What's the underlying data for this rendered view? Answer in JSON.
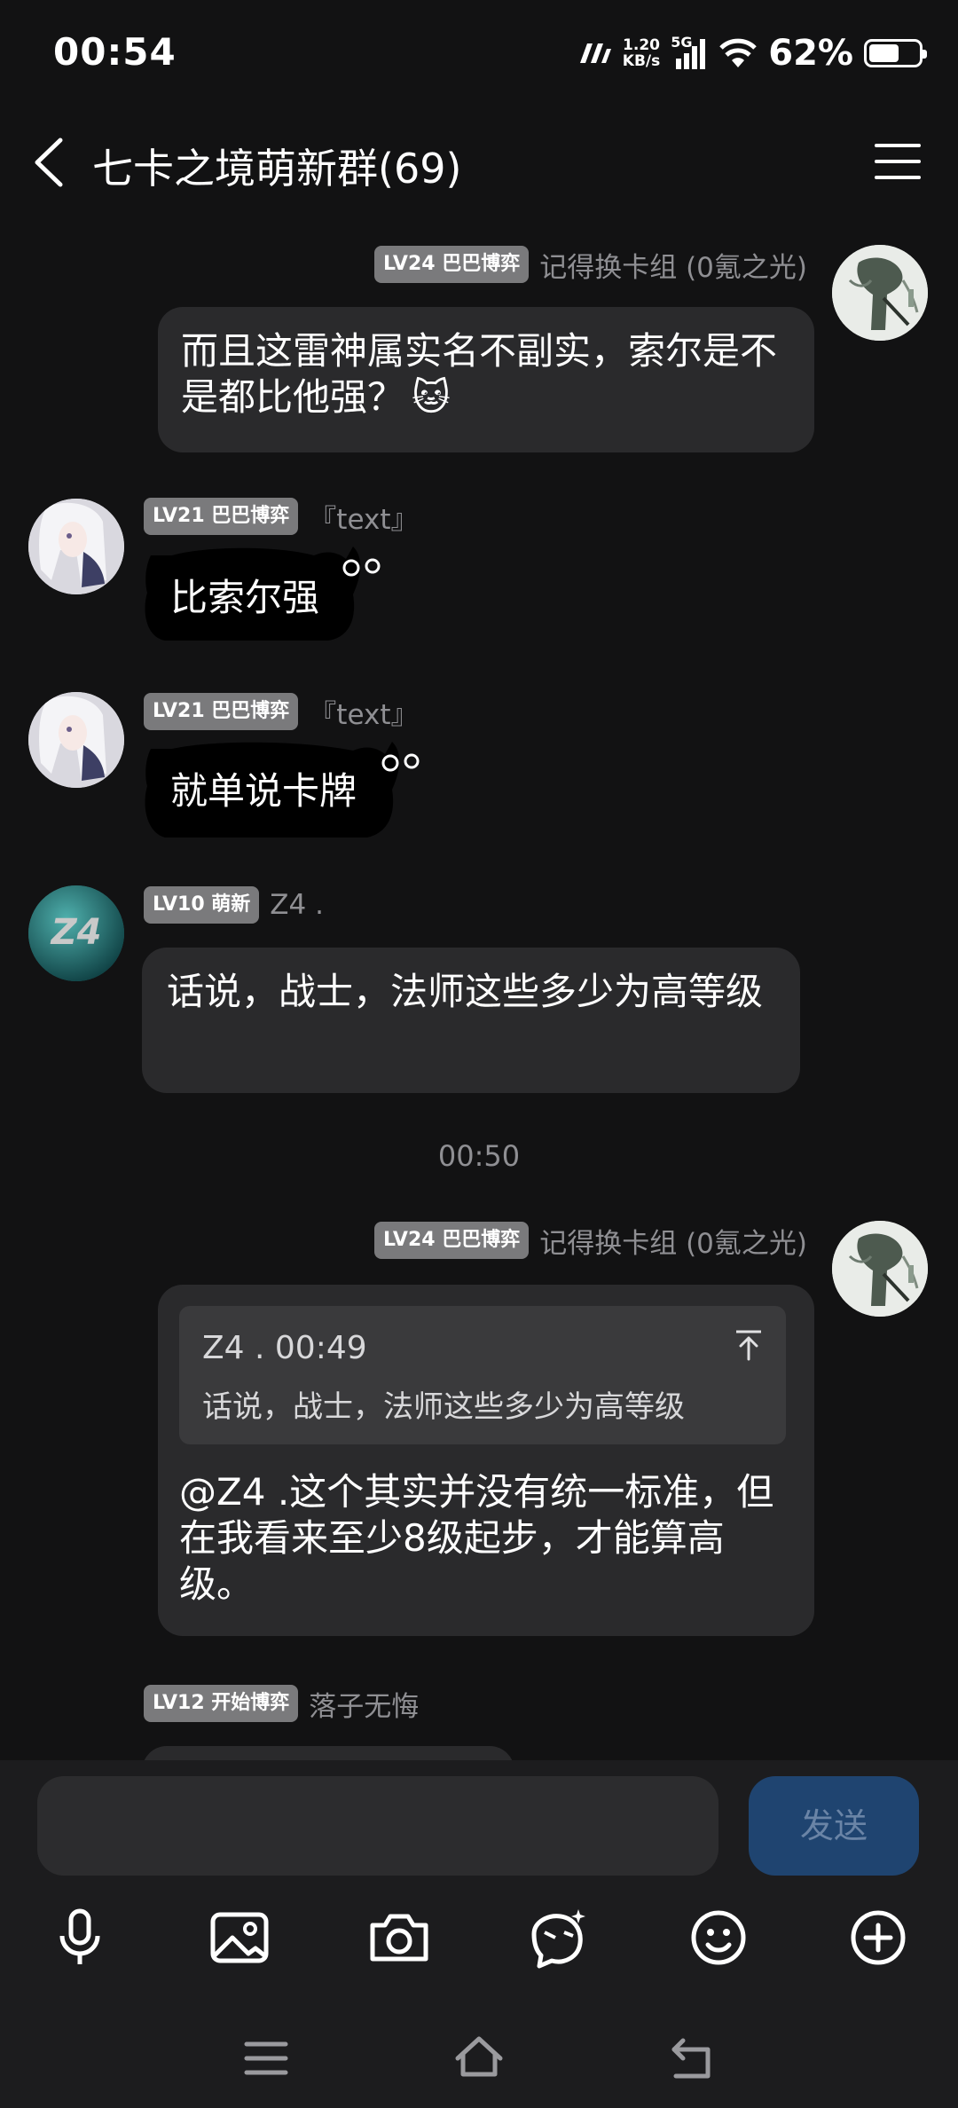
{
  "status_bar": {
    "time": "00:54",
    "speed_value": "1.20",
    "speed_unit": "KB/s",
    "network": "5G",
    "battery_percent": "62%",
    "battery_level": 0.62
  },
  "header": {
    "title": "七卡之境萌新群(69)"
  },
  "messages": [
    {
      "level": "LV24 巴巴博弈",
      "nickname": "记得换卡组 (0氪之光)",
      "text": "而且这雷神属实名不副实，索尔是不是都比他强？",
      "emoji": "🐱"
    },
    {
      "level": "LV21 巴巴博弈",
      "nickname": "『text』",
      "text": "比索尔强"
    },
    {
      "level": "LV21 巴巴博弈",
      "nickname": "『text』",
      "text": "就单说卡牌"
    },
    {
      "level": "LV10 萌新",
      "nickname": "Z4 .",
      "avatar_text": "Z4",
      "text": "话说，战士，法师这些多少为高等级"
    },
    {
      "level": "LV24 巴巴博弈",
      "nickname": "记得换卡组 (0氪之光)",
      "quote_head": "Z4 . 00:49",
      "quote_text": "话说，战士，法师这些多少为高等级",
      "text": "@Z4 .这个其实并没有统一标准，但在我看来至少8级起步，才能算高级。"
    },
    {
      "level": "LV12 开始博弈",
      "nickname": "落子无悔"
    }
  ],
  "time_separator": "00:50",
  "input_bar": {
    "send_label": "发送",
    "tools": [
      "microphone-icon",
      "image-icon",
      "camera-icon",
      "sticker-icon",
      "emoji-icon",
      "plus-icon"
    ]
  },
  "nav_bar": [
    "menu-icon",
    "home-icon",
    "back-icon"
  ],
  "colors": {
    "background": "#121213",
    "bubble": "#2a2a2c",
    "level_badge": "#7a7a7c",
    "send_button": "#1f4470"
  }
}
